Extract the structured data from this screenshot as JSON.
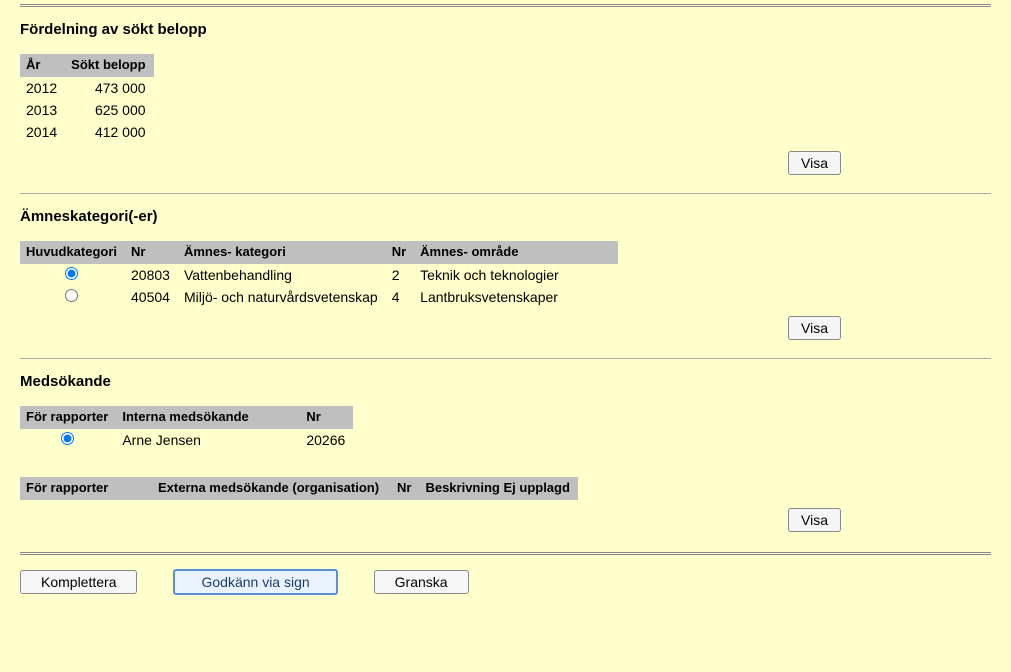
{
  "section1": {
    "title": "Fördelning av sökt belopp",
    "headers": {
      "year": "År",
      "amount": "Sökt belopp"
    },
    "rows": [
      {
        "year": "2012",
        "amount": "473 000"
      },
      {
        "year": "2013",
        "amount": "625 000"
      },
      {
        "year": "2014",
        "amount": "412 000"
      }
    ],
    "button": "Visa"
  },
  "section2": {
    "title": "Ämneskategori(-er)",
    "headers": {
      "main": "Huvudkategori",
      "nr1": "Nr",
      "cat": "Ämnes-\nkategori",
      "nr2": "Nr",
      "area": "Ämnes-\nområde"
    },
    "rows": [
      {
        "selected": true,
        "nr1": "20803",
        "cat": "Vattenbehandling",
        "nr2": "2",
        "area": "Teknik och teknologier"
      },
      {
        "selected": false,
        "nr1": "40504",
        "cat": "Miljö- och naturvårdsvetenskap",
        "nr2": "4",
        "area": "Lantbruksvetenskaper"
      }
    ],
    "button": "Visa"
  },
  "section3": {
    "title": "Medsökande",
    "internal": {
      "headers": {
        "rep": "För rapporter",
        "name": "Interna medsökande",
        "nr": "Nr"
      },
      "rows": [
        {
          "selected": true,
          "name": "Arne Jensen",
          "nr": "20266"
        }
      ]
    },
    "external": {
      "headers": {
        "rep": "För rapporter",
        "org": "Externa\nmedsökande (organisation)",
        "nr": "Nr",
        "desc": "Beskrivning\nEj upplagd"
      }
    },
    "button": "Visa"
  },
  "bottom": {
    "complete": "Komplettera",
    "approve": "Godkänn via sign",
    "review": "Granska"
  }
}
